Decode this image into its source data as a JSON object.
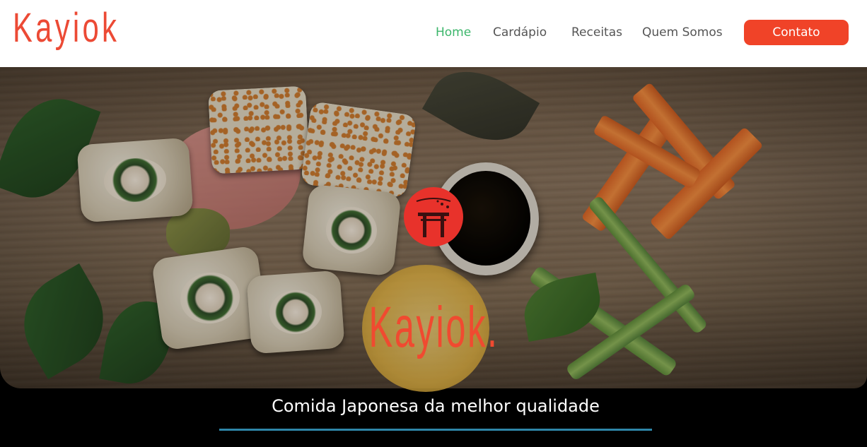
{
  "brand": {
    "logo_text": "Kayiok"
  },
  "nav": {
    "items": [
      {
        "label": "Home",
        "active": true
      },
      {
        "label": "Cardápio",
        "active": false
      },
      {
        "label": "Receitas",
        "active": false
      },
      {
        "label": "Quem Somos",
        "active": false
      }
    ],
    "contact_label": "Contato"
  },
  "hero": {
    "title": "Kayiok.",
    "tagline": "Comida Japonesa da melhor qualidade",
    "emblem_icon": "torii-gate-icon"
  },
  "colors": {
    "accent_red": "#f04328",
    "nav_active": "#3cb66b",
    "underline_blue": "#2e86a8"
  }
}
